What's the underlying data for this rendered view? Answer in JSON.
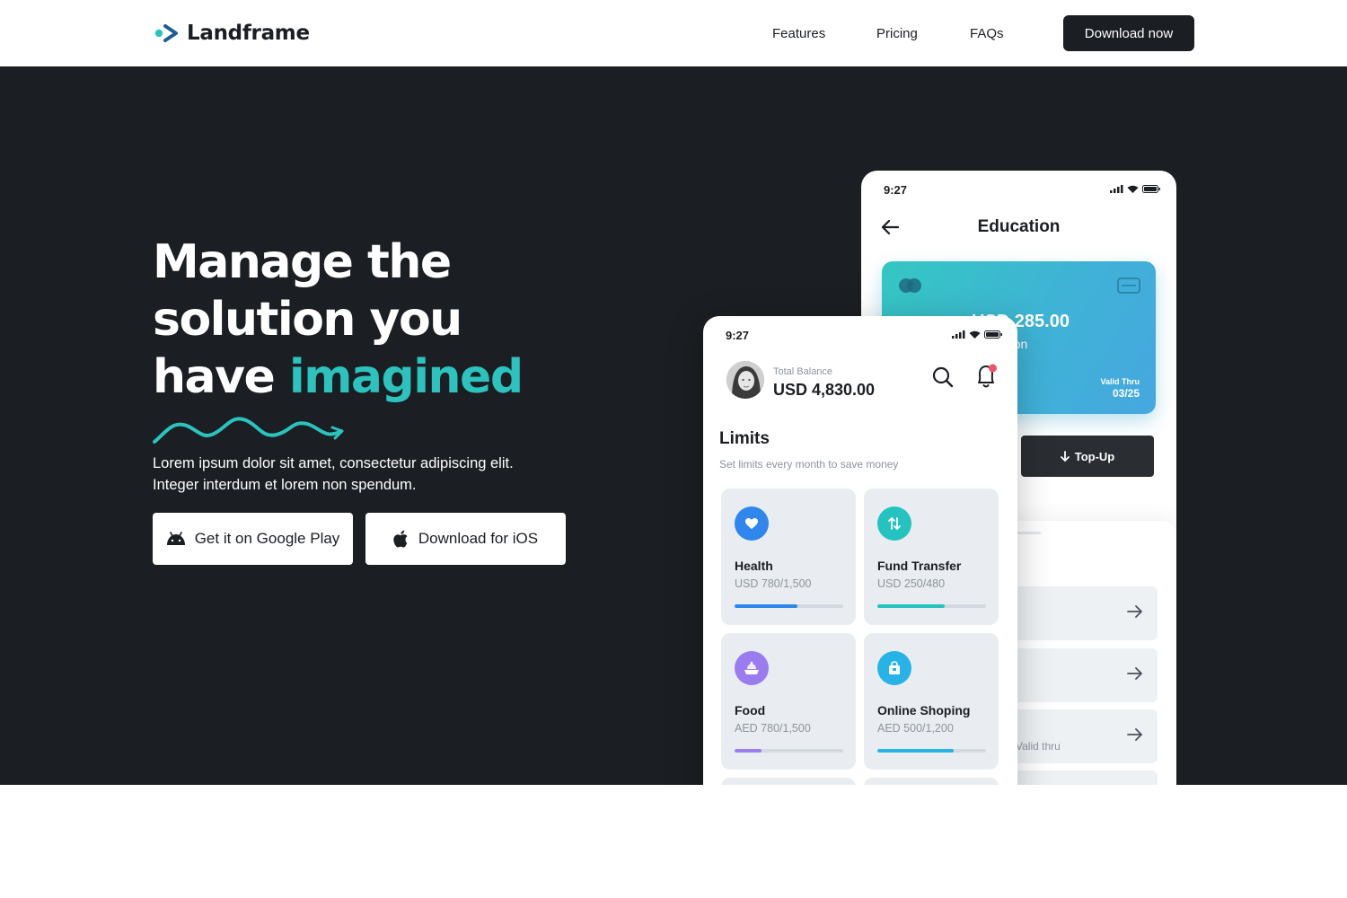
{
  "nav": {
    "logo_text": "Landframe",
    "links": [
      "Features",
      "Pricing",
      "FAQs"
    ],
    "cta_label": "Download now"
  },
  "hero": {
    "headline_line1": "Manage the",
    "headline_line2": "solution you",
    "headline_line3_plain": "have ",
    "headline_line3_accent": "imagined",
    "description_line1": "Lorem ipsum dolor sit amet, consectetur adipiscing elit.",
    "description_line2": "Integer interdum et lorem non spendum.",
    "google_play_label": "Get it on Google Play",
    "ios_label": "Download for iOS",
    "accent_color": "#2cc3bf"
  },
  "phone_back": {
    "time": "9:27",
    "title": "Education",
    "card_amount": "USD 285.00",
    "card_sub": "Education",
    "valid_label": "Valid Thru",
    "valid_date": "03/25",
    "topup_label": "Top-Up",
    "row3_text": "Valid thru"
  },
  "phone_front": {
    "time": "9:27",
    "balance_label": "Total Balance",
    "balance_value": "USD 4,830.00",
    "limits_title": "Limits",
    "limits_sub": "Set limits every month to save money",
    "tiles": [
      {
        "name": "Health",
        "amount": "USD 780/1,500",
        "progress": 0.58,
        "color": "#2f86ec",
        "icon": "heart-icon"
      },
      {
        "name": "Fund Transfer",
        "amount": "USD 250/480",
        "progress": 0.62,
        "color": "#25c3bf",
        "icon": "transfer-icon"
      },
      {
        "name": "Food",
        "amount": "AED 780/1,500",
        "progress": 0.25,
        "color": "#9b7cf0",
        "icon": "food-icon"
      },
      {
        "name": "Online Shoping",
        "amount": "AED 500/1,200",
        "progress": 0.7,
        "color": "#27b3e6",
        "icon": "shopping-bag-icon"
      }
    ]
  }
}
